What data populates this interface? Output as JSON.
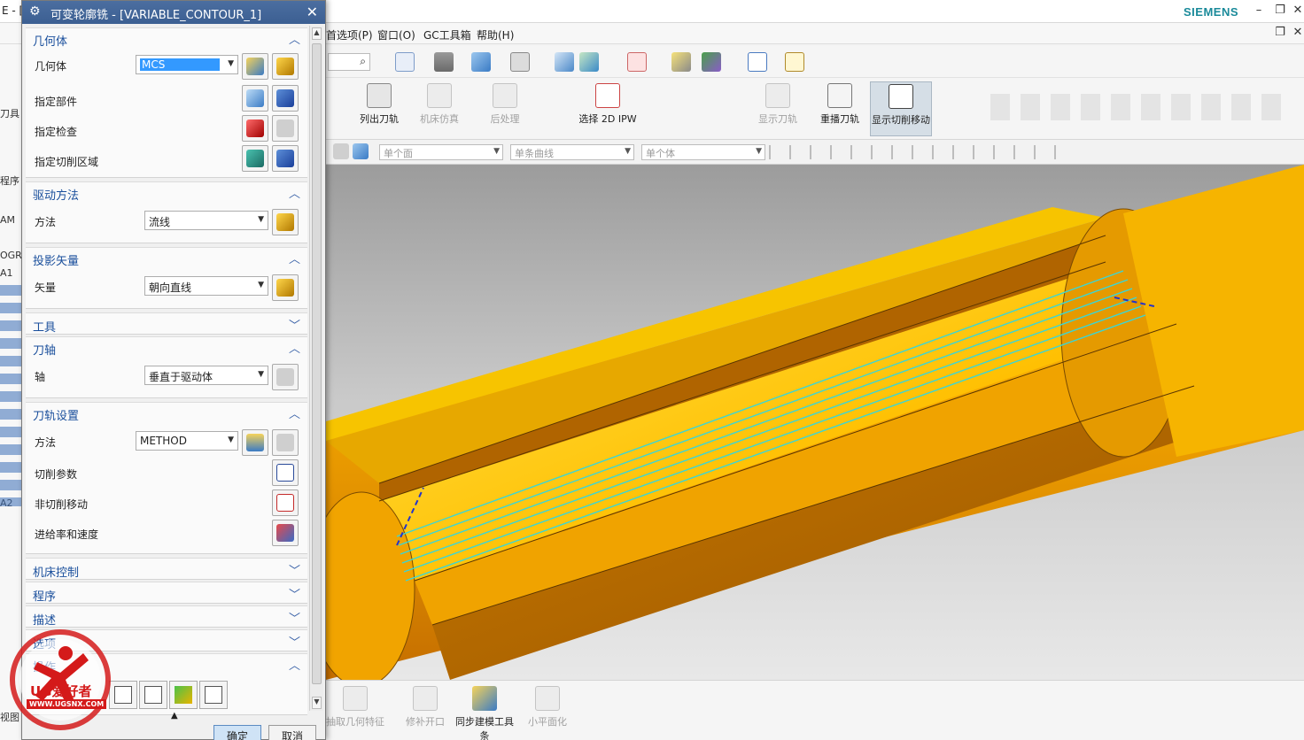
{
  "window": {
    "left_title_fragment": "E - [",
    "brand": "SIEMENS",
    "menus": [
      "首选项(P)",
      "窗口(O)",
      "GC工具箱",
      "帮助(H)"
    ]
  },
  "dialog": {
    "title": "可变轮廓铣 - [VARIABLE_CONTOUR_1]",
    "groups": {
      "geometry": {
        "title": "几何体",
        "geometry_label": "几何体",
        "geometry_value": "MCS",
        "part_label": "指定部件",
        "check_label": "指定检查",
        "cut_area_label": "指定切削区域"
      },
      "drive": {
        "title": "驱动方法",
        "method_label": "方法",
        "method_value": "流线"
      },
      "projection": {
        "title": "投影矢量",
        "vector_label": "矢量",
        "vector_value": "朝向直线"
      },
      "tool": {
        "title": "工具"
      },
      "tool_axis": {
        "title": "刀轴",
        "axis_label": "轴",
        "axis_value": "垂直于驱动体"
      },
      "path_settings": {
        "title": "刀轨设置",
        "method_label": "方法",
        "method_value": "METHOD",
        "cut_params_label": "切削参数",
        "non_cut_label": "非切削移动",
        "feeds_label": "进给率和速度"
      },
      "machine_control": {
        "title": "机床控制"
      },
      "program": {
        "title": "程序"
      },
      "description": {
        "title": "描述"
      },
      "options": {
        "title": "选项"
      },
      "actions": {
        "title": "操作"
      }
    },
    "ok_label": "确定",
    "cancel_label": "取消"
  },
  "ribbon": {
    "buttons": [
      "列出刀轨",
      "机床仿真",
      "后处理",
      "选择 2D IPW",
      "显示刀轨",
      "重播刀轨",
      "显示切削移动"
    ],
    "selection_filters": [
      "单个面",
      "单条曲线",
      "单个体"
    ]
  },
  "bottom_ribbon": {
    "buttons": [
      "抽取几何特征",
      "修补开口",
      "同步建模工具条",
      "小平面化"
    ]
  },
  "left_strip": {
    "items": [
      "刀具",
      "程序",
      "AM",
      "OGR",
      "A1",
      "A2",
      "视图"
    ]
  },
  "watermark": {
    "text": "UG爱好者",
    "url": "WWW.UGSNX.COM"
  }
}
